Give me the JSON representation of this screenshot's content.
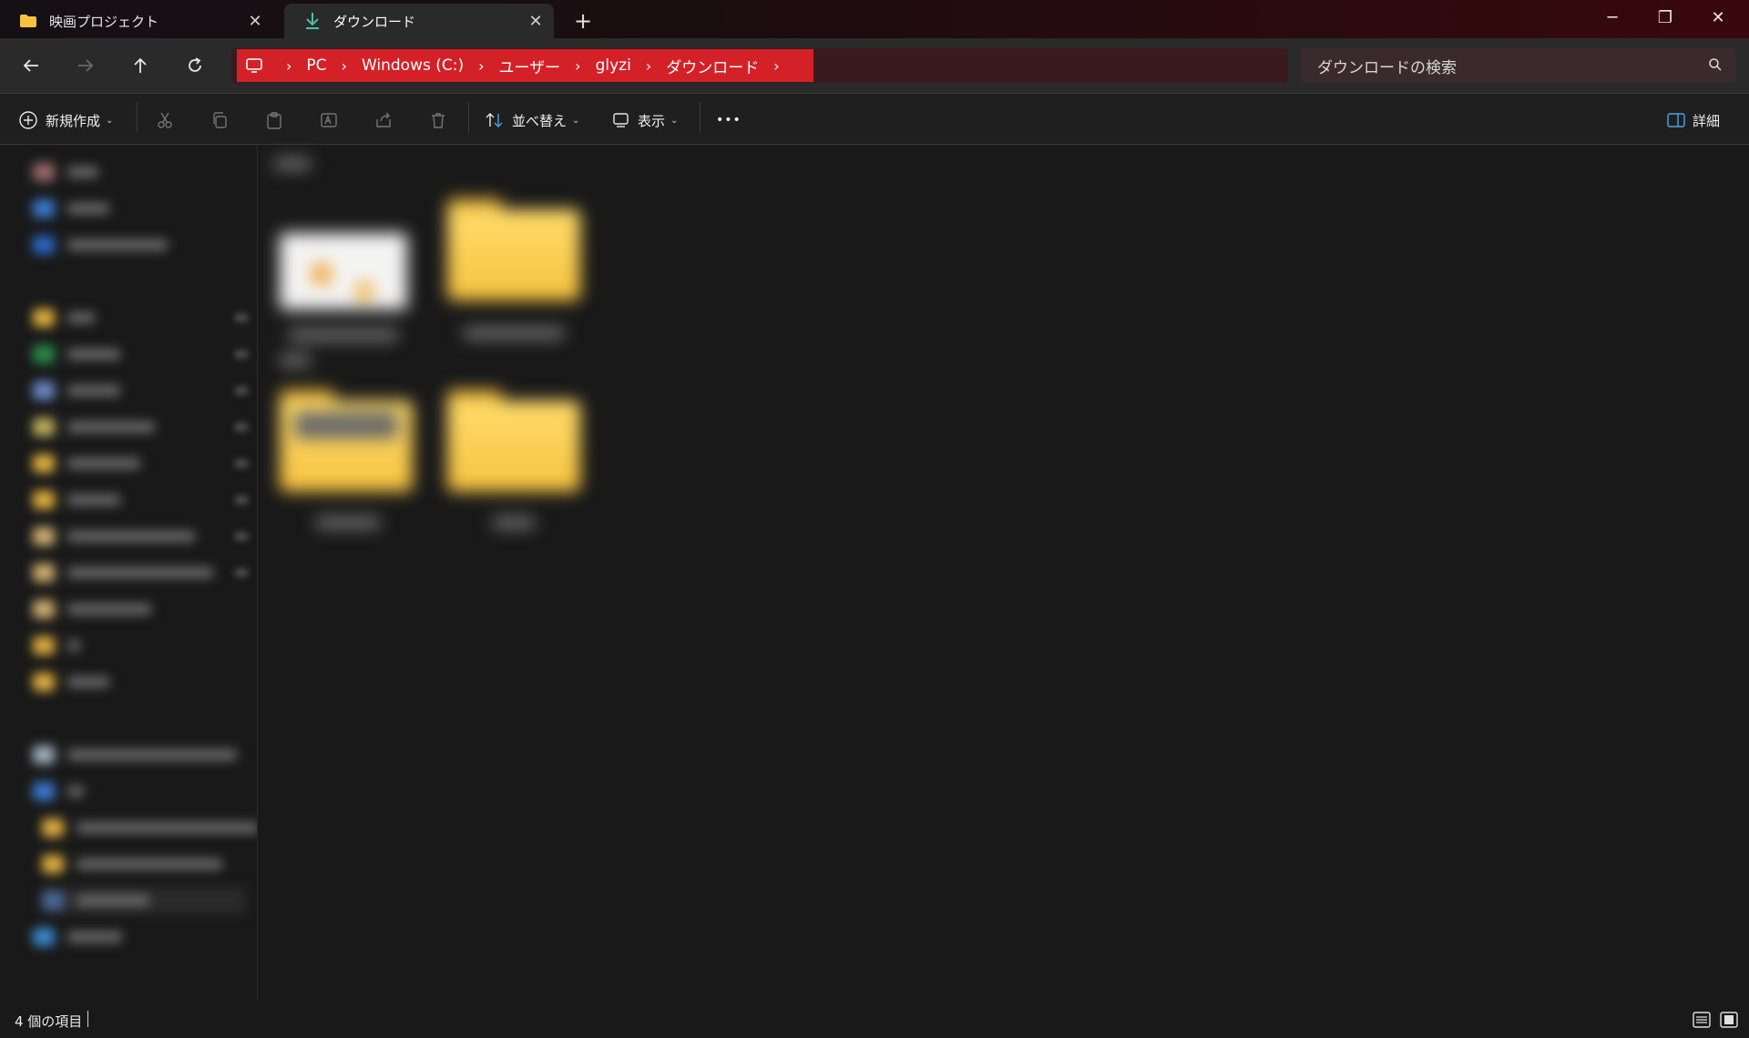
{
  "tabs": [
    {
      "label": "映画プロジェクト",
      "icon": "folder-icon",
      "active": false,
      "close": "✕"
    },
    {
      "label": "ダウンロード",
      "icon": "download-icon",
      "active": true,
      "close": "✕"
    }
  ],
  "new_tab_label": "+",
  "window_controls": {
    "minimize": "─",
    "restore": "❐",
    "close": "✕"
  },
  "nav": {
    "back": "back-arrow-icon",
    "forward": "forward-arrow-icon",
    "up": "up-arrow-icon",
    "refresh": "refresh-icon"
  },
  "breadcrumb": {
    "root_icon": "monitor-icon",
    "items": [
      "PC",
      "Windows (C:)",
      "ユーザー",
      "glyzi",
      "ダウンロード"
    ],
    "separator": "›",
    "highlight_color": "#d42128"
  },
  "search": {
    "placeholder": "ダウンロードの検索",
    "icon": "search-icon"
  },
  "toolbar": {
    "new_label": "新規作成",
    "sort_label": "並べ替え",
    "view_label": "表示",
    "more_label": "•••",
    "details_label": "詳細",
    "disabled_icons": [
      "cut-icon",
      "copy-icon",
      "paste-icon",
      "rename-icon",
      "share-icon",
      "delete-icon"
    ]
  },
  "status": {
    "item_count": "4 個の項目"
  },
  "colors": {
    "folder": "#f6c240",
    "accent": "#d42128"
  }
}
